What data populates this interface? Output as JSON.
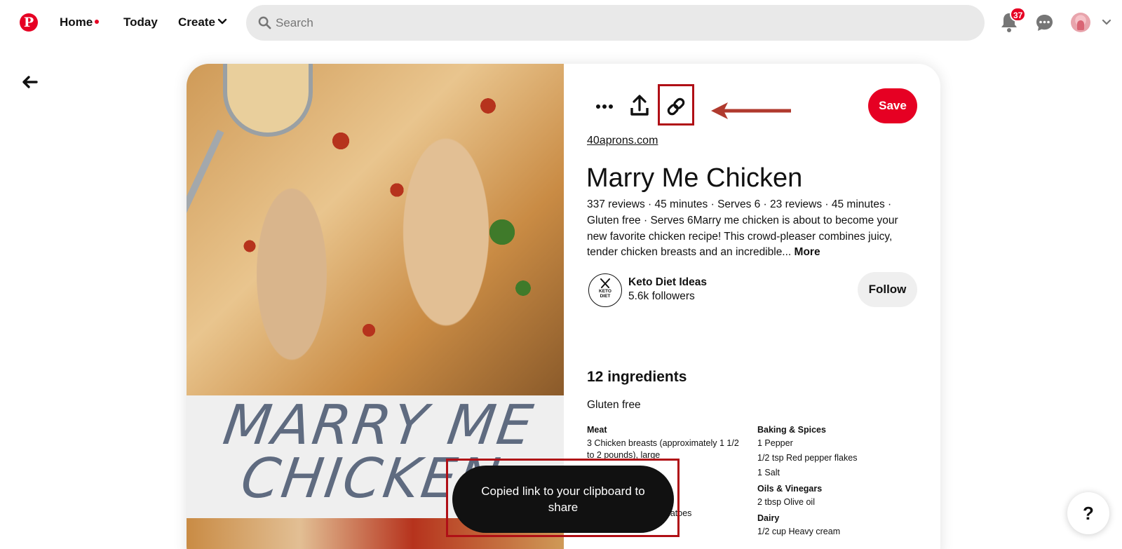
{
  "header": {
    "logo_letter": "P",
    "nav": {
      "home": "Home",
      "today": "Today",
      "create": "Create"
    },
    "search_placeholder": "Search",
    "notifications_count": "37"
  },
  "pin": {
    "image_title_line1": "MARRY ME",
    "image_title_line2": "CHICKEN",
    "save_label": "Save",
    "source": "40aprons.com",
    "title": "Marry Me Chicken",
    "description": "337 reviews · 45 minutes · Serves 6 · 23 reviews · 45 minutes · Gluten free · Serves 6Marry me chicken is about to become your new favorite chicken recipe! This crowd-pleaser combines juicy, tender chicken breasts and an incredible...",
    "more_label": "More",
    "creator": {
      "badge_line1": "KETO",
      "badge_line2": "DIET",
      "name": "Keto Diet Ideas",
      "followers": "5.6k followers",
      "follow_label": "Follow"
    },
    "ingredients": {
      "title": "12 ingredients",
      "tag": "Gluten free",
      "left": [
        {
          "group": "Meat",
          "items": [
            "3 Chicken breasts (approximately 1 1/2 to 2 pounds), large"
          ]
        },
        {
          "group": "",
          "items": [
            "1/2 cup Sundried tomatoes"
          ]
        }
      ],
      "right": [
        {
          "group": "Baking & Spices",
          "items": [
            "1 Pepper",
            "1/2 tsp Red pepper flakes",
            "1 Salt"
          ]
        },
        {
          "group": "Oils & Vinegars",
          "items": [
            "2 tbsp Olive oil"
          ]
        },
        {
          "group": "Dairy",
          "items": [
            "1/2 cup Heavy cream"
          ]
        }
      ]
    }
  },
  "toast": {
    "message": "Copied link to your clipboard to share"
  },
  "help_label": "?",
  "colors": {
    "brand": "#e60023",
    "annotation": "#b00f16"
  }
}
